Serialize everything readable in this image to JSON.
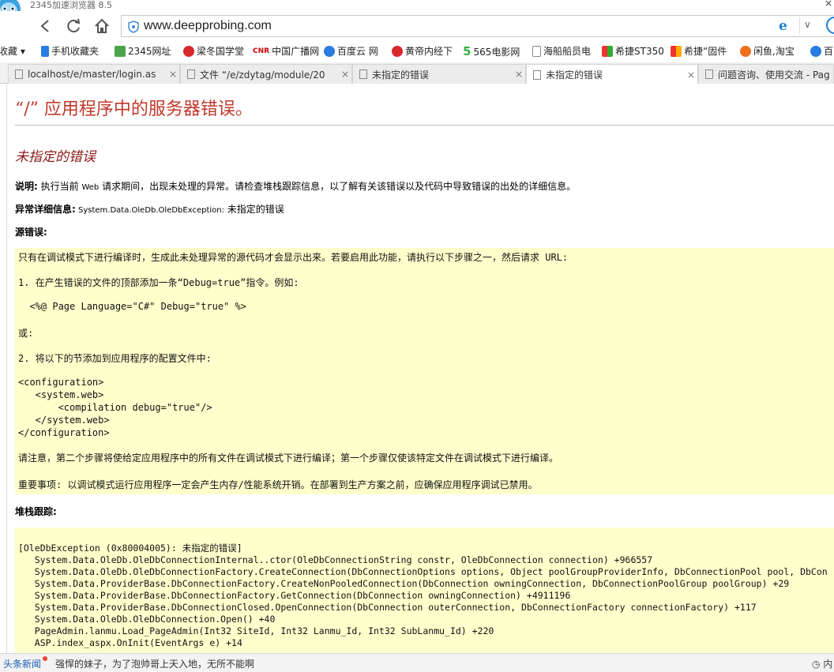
{
  "browser": {
    "title": "2345加速浏览器 8.5",
    "close_glyph": "×",
    "address_url": "www.deepprobing.com",
    "ie_mode_glyph": "e",
    "dropdown_glyph": "∨",
    "accent_color": "#1b7fd5"
  },
  "bookmarks": [
    {
      "label": "收藏 ▾",
      "icon": "none"
    },
    {
      "label": "手机收藏夹",
      "icon": "phone-icon"
    },
    {
      "label": "2345网址",
      "icon": "home-icon"
    },
    {
      "label": "梁冬国学堂",
      "icon": "weibo-icon"
    },
    {
      "label": "中国广播网",
      "icon": "cnr-logo",
      "prefix": "CNR"
    },
    {
      "label": "百度云 网",
      "icon": "baidu-cloud-icon"
    },
    {
      "label": "黄帝内经下",
      "icon": "weibo-icon"
    },
    {
      "label": "565电影网",
      "icon": "565-icon",
      "prefix": "5"
    },
    {
      "label": "海船船员电",
      "icon": "page-icon"
    },
    {
      "label": "希捷ST350",
      "icon": "grid-icon"
    },
    {
      "label": "希捷“固件",
      "icon": "grid-icon"
    },
    {
      "label": "闲鱼,淘宝",
      "icon": "xianyu-icon"
    },
    {
      "label": "百",
      "icon": "baidu-cloud-icon"
    }
  ],
  "tabs": [
    {
      "label": "localhost/e/master/login.as",
      "close": "×"
    },
    {
      "label": "文件 “/e/zdytag/module/20",
      "close": "×"
    },
    {
      "label": "未指定的错误",
      "close": "×"
    },
    {
      "label": "未指定的错误",
      "close": "×"
    },
    {
      "label": "问题咨询、使用交流 - Pag",
      "close": ""
    }
  ],
  "page": {
    "heading": "“/” 应用程序中的服务器错误。",
    "subheading": "未指定的错误",
    "description_label": "说明:",
    "description_a": " 执行当前 ",
    "description_web": "Web",
    "description_b": " 请求期间，出现未处理的异常。请检查堆栈跟踪信息，以了解有关该错误以及代码中导致错误的出处的详细信息。",
    "exception_label": "异常详细信息:",
    "exception_type": " System.Data.OleDb.OleDbException:",
    "exception_msg": " 未指定的错误",
    "source_label": "源错误:",
    "source_lines": [
      "只有在调试模式下进行编译时，生成此未处理异常的源代码才会显示出来。若要启用此功能，请执行以下步骤之一，然后请求 URL:",
      "1. 在产生错误的文件的顶部添加一条“Debug=true”指令。例如:",
      "  <%@ Page Language=\"C#\" Debug=\"true\" %>",
      "或:",
      "2. 将以下的节添加到应用程序的配置文件中:",
      "<configuration>",
      "   <system.web>",
      "       <compilation debug=\"true\"/>",
      "   </system.web>",
      "</configuration>",
      "请注意，第二个步骤将使给定应用程序中的所有文件在调试模式下进行编译；第一个步骤仅使该特定文件在调试模式下进行编译。",
      "重要事项: 以调试模式运行应用程序一定会产生内存/性能系统开销。在部署到生产方案之前，应确保应用程序调试已禁用。"
    ],
    "stack_label": "堆栈跟踪:",
    "stack_lines": [
      "[OleDbException (0x80004005): 未指定的错误]",
      "   System.Data.OleDb.OleDbConnectionInternal..ctor(OleDbConnectionString constr, OleDbConnection connection) +966557",
      "   System.Data.OleDb.OleDbConnectionFactory.CreateConnection(DbConnectionOptions options, Object poolGroupProviderInfo, DbConnectionPool pool, DbCon",
      "   System.Data.ProviderBase.DbConnectionFactory.CreateNonPooledConnection(DbConnection owningConnection, DbConnectionPoolGroup poolGroup) +29",
      "   System.Data.ProviderBase.DbConnectionFactory.GetConnection(DbConnection owningConnection) +4911196",
      "   System.Data.ProviderBase.DbConnectionClosed.OpenConnection(DbConnection outerConnection, DbConnectionFactory connectionFactory) +117",
      "   System.Data.OleDb.OleDbConnection.Open() +40",
      "   PageAdmin.lanmu.Load_PageAdmin(Int32 SiteId, Int32 Lanmu_Id, Int32 SubLanmu_Id) +220",
      "   ASP.index_aspx.OnInit(EventArgs e) +14"
    ],
    "heading_color": "#c0392b",
    "code_bg_color": "#ffffcc"
  },
  "statusbar": {
    "news_label": "头条新闻",
    "news_text": "强悍的妹子，为了泡帅哥上天入地，无所不能啊",
    "right_text": "◷ 内"
  }
}
